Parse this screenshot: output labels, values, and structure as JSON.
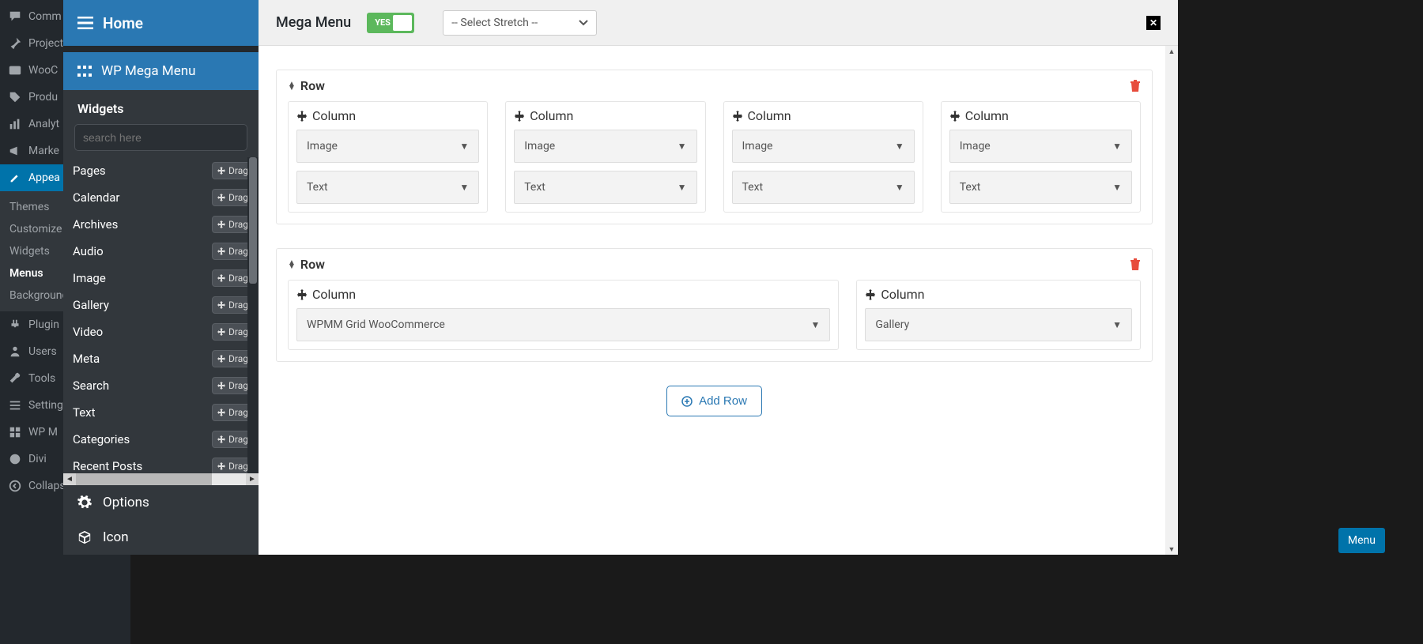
{
  "wp_sidebar": {
    "items": [
      {
        "label": "Comm"
      },
      {
        "label": "Project"
      },
      {
        "label": "WooC"
      },
      {
        "label": "Produ"
      },
      {
        "label": "Analyt"
      },
      {
        "label": "Marke"
      }
    ],
    "appearance": {
      "label": "Appea",
      "sub": [
        {
          "label": "Themes",
          "bold": false
        },
        {
          "label": "Customize",
          "bold": false
        },
        {
          "label": "Widgets",
          "bold": false
        },
        {
          "label": "Menus",
          "bold": true
        },
        {
          "label": "Background",
          "bold": false
        }
      ]
    },
    "after": [
      {
        "label": "Plugin"
      },
      {
        "label": "Users"
      },
      {
        "label": "Tools"
      },
      {
        "label": "Setting"
      },
      {
        "label": "WP M"
      },
      {
        "label": "Divi"
      },
      {
        "label": "Collaps"
      }
    ]
  },
  "home_label": "Home",
  "wpmega_label": "WP Mega Menu",
  "widgets_title": "Widgets",
  "search_placeholder": "search here",
  "widgets": [
    "Pages",
    "Calendar",
    "Archives",
    "Audio",
    "Image",
    "Gallery",
    "Video",
    "Meta",
    "Search",
    "Text",
    "Categories",
    "Recent Posts"
  ],
  "drag_label": "Drag",
  "options_label": "Options",
  "icon_label": "Icon",
  "mega_title": "Mega Menu",
  "toggle_label": "YES",
  "stretch_select": "-- Select Stretch --",
  "row_label": "Row",
  "column_label": "Column",
  "add_row_label": "Add Row",
  "rows": [
    {
      "columns": [
        {
          "widgets": [
            "Image",
            "Text"
          ]
        },
        {
          "widgets": [
            "Image",
            "Text"
          ]
        },
        {
          "widgets": [
            "Image",
            "Text"
          ]
        },
        {
          "widgets": [
            "Image",
            "Text"
          ]
        }
      ]
    },
    {
      "columns": [
        {
          "widgets": [
            "WPMM Grid WooCommerce"
          ],
          "flex": 2
        },
        {
          "widgets": [
            "Gallery"
          ],
          "flex": 1
        }
      ]
    }
  ],
  "save_menu_label": "Menu"
}
